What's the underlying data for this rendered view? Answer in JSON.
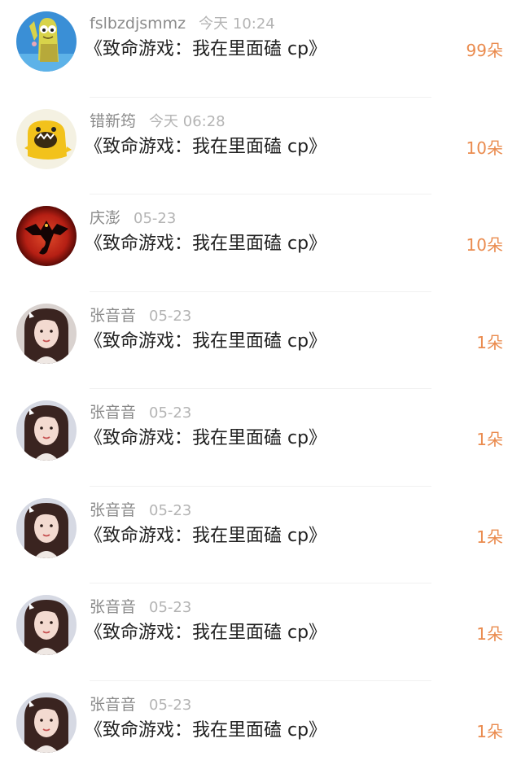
{
  "items": [
    {
      "user": "fslbzdjsmmz",
      "time": "今天 10:24",
      "title": "《致命游戏：我在里面磕 cp》",
      "count": "99朵",
      "avatar_icon": "cartoon-sponge-avatar-icon"
    },
    {
      "user": "错新筠",
      "time": "今天 06:28",
      "title": "《致命游戏：我在里面磕 cp》",
      "count": "10朵",
      "avatar_icon": "yellow-monster-avatar-icon"
    },
    {
      "user": "庆澎",
      "time": "05-23",
      "title": "《致命游戏：我在里面磕 cp》",
      "count": "10朵",
      "avatar_icon": "red-dragon-avatar-icon"
    },
    {
      "user": "张音音",
      "time": "05-23",
      "title": "《致命游戏：我在里面磕 cp》",
      "count": "1朵",
      "avatar_icon": "girl-photo-avatar-icon"
    },
    {
      "user": "张音音",
      "time": "05-23",
      "title": "《致命游戏：我在里面磕 cp》",
      "count": "1朵",
      "avatar_icon": "girl-photo-avatar-icon"
    },
    {
      "user": "张音音",
      "time": "05-23",
      "title": "《致命游戏：我在里面磕 cp》",
      "count": "1朵",
      "avatar_icon": "girl-photo-avatar-icon"
    },
    {
      "user": "张音音",
      "time": "05-23",
      "title": "《致命游戏：我在里面磕 cp》",
      "count": "1朵",
      "avatar_icon": "girl-photo-avatar-icon"
    },
    {
      "user": "张音音",
      "time": "05-23",
      "title": "《致命游戏：我在里面磕 cp》",
      "count": "1朵",
      "avatar_icon": "girl-photo-avatar-icon"
    }
  ],
  "colors": {
    "count_accent": "#ea8b4e",
    "username": "#8a8a8a",
    "timestamp": "#b4b4b4",
    "title": "#222222",
    "divider": "#f0f0f0"
  }
}
